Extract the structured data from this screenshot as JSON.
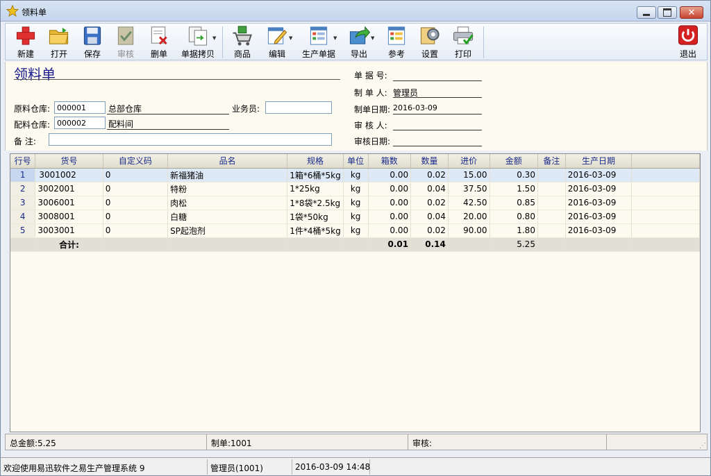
{
  "window": {
    "title": "领料单"
  },
  "toolbar": {
    "new": "新建",
    "open": "打开",
    "save": "保存",
    "audit": "审核",
    "delete": "删单",
    "copy": "单据拷贝",
    "goods": "商品",
    "edit": "编辑",
    "production": "生产单据",
    "export": "导出",
    "reference": "参考",
    "settings": "设置",
    "print": "打印",
    "exit": "退出"
  },
  "form": {
    "title": "领料单",
    "raw_wh_label": "原料仓库:",
    "raw_wh_code": "000001",
    "raw_wh_name": "总部仓库",
    "mix_wh_label": "配料仓库:",
    "mix_wh_code": "000002",
    "mix_wh_name": "配料间",
    "staff_label": "业务员:",
    "staff_value": "",
    "note_label": "备  注:",
    "note_value": "",
    "doc_no_label": "单 据 号:",
    "doc_no": "",
    "maker_label": "制 单 人:",
    "maker": "管理员",
    "date_label": "制单日期:",
    "date": "2016-03-09",
    "auditor_label": "审 核 人:",
    "auditor": "",
    "audit_date_label": "审核日期:",
    "audit_date": ""
  },
  "grid": {
    "columns": [
      "行号",
      "货号",
      "自定义码",
      "品名",
      "规格",
      "单位",
      "箱数",
      "数量",
      "进价",
      "金额",
      "备注",
      "生产日期"
    ],
    "rows": [
      {
        "no": "1",
        "code": "3001002",
        "custom": "0",
        "name": "新福猪油",
        "spec": "1箱*6桶*5kg",
        "unit": "kg",
        "boxes": "0.00",
        "qty": "0.02",
        "price": "15.00",
        "amount": "0.30",
        "note": "",
        "date": "2016-03-09"
      },
      {
        "no": "2",
        "code": "3002001",
        "custom": "0",
        "name": "特粉",
        "spec": "1*25kg",
        "unit": "kg",
        "boxes": "0.00",
        "qty": "0.04",
        "price": "37.50",
        "amount": "1.50",
        "note": "",
        "date": "2016-03-09"
      },
      {
        "no": "3",
        "code": "3006001",
        "custom": "0",
        "name": "肉松",
        "spec": "1*8袋*2.5kg",
        "unit": "kg",
        "boxes": "0.00",
        "qty": "0.02",
        "price": "42.50",
        "amount": "0.85",
        "note": "",
        "date": "2016-03-09"
      },
      {
        "no": "4",
        "code": "3008001",
        "custom": "0",
        "name": "白糖",
        "spec": "1袋*50kg",
        "unit": "kg",
        "boxes": "0.00",
        "qty": "0.04",
        "price": "20.00",
        "amount": "0.80",
        "note": "",
        "date": "2016-03-09"
      },
      {
        "no": "5",
        "code": "3003001",
        "custom": "0",
        "name": "SP起泡剂",
        "spec": "1件*4桶*5kg",
        "unit": "kg",
        "boxes": "0.00",
        "qty": "0.02",
        "price": "90.00",
        "amount": "1.80",
        "note": "",
        "date": "2016-03-09"
      }
    ],
    "total": {
      "label": "合计:",
      "boxes": "0.01",
      "qty": "0.14",
      "amount": "5.25"
    }
  },
  "summary": {
    "total": "总金额:5.25",
    "maker": "制单:1001",
    "auditor": "审核:"
  },
  "status": {
    "welcome": "欢迎使用易迅软件之易生产管理系统 9",
    "user": "管理员(1001)",
    "datetime": "2016-03-09 14:48"
  },
  "colors": {
    "title": "#1a1a8c",
    "selection": "#3d7fd0",
    "exit": "#d42020"
  }
}
